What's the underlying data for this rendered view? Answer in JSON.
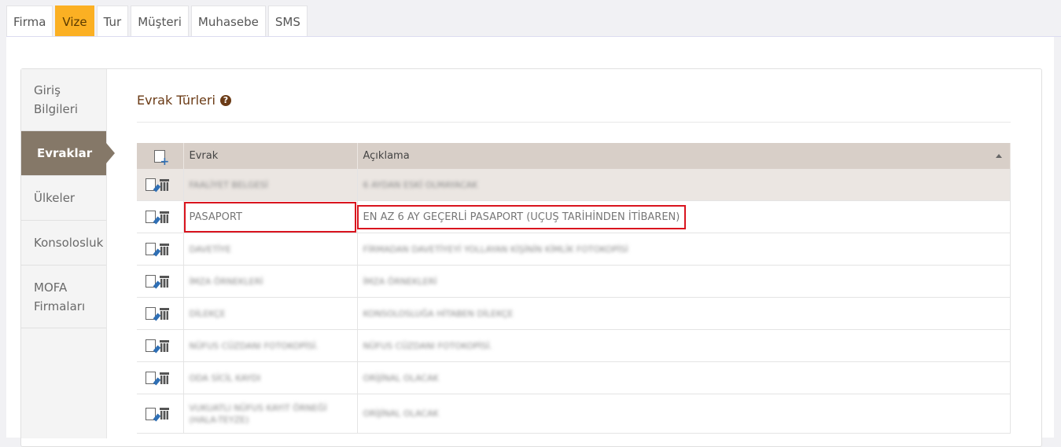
{
  "tabs": [
    "Firma",
    "Vize",
    "Tur",
    "Müşteri",
    "Muhasebe",
    "SMS"
  ],
  "active_tab": "Vize",
  "sidenav": [
    {
      "label": "Giriş Bilgileri",
      "lines": [
        "Giriş",
        "Bilgileri"
      ]
    },
    {
      "label": "Evraklar",
      "lines": [
        "Evraklar"
      ]
    },
    {
      "label": "Ülkeler",
      "lines": [
        "Ülkeler"
      ]
    },
    {
      "label": "Konsolosluk",
      "lines": [
        "Konsolosluk"
      ]
    },
    {
      "label": "MOFA Firmaları",
      "lines": [
        "MOFA",
        "Firmaları"
      ]
    }
  ],
  "active_nav": "Evraklar",
  "section_title": "Evrak Türleri",
  "table": {
    "columns": [
      "",
      "Evrak",
      "Açıklama"
    ],
    "rows": [
      {
        "evrak": "FAALİYET BELGESİ",
        "aciklama": "6 AYDAN ESKİ OLMAYACAK",
        "blurred": true
      },
      {
        "evrak": "PASAPORT",
        "aciklama": "EN AZ 6 AY GEÇERLİ PASAPORT (UÇUŞ TARİHİNDEN İTİBAREN)",
        "blurred": false,
        "highlighted": true
      },
      {
        "evrak": "DAVETİYE",
        "aciklama": "FİRMADAN DAVETİYEYİ YOLLAYAN KİŞİNİN KİMLİK FOTOKOPİSİ",
        "blurred": true
      },
      {
        "evrak": "İMZA ÖRNEKLERİ",
        "aciklama": "İMZA ÖRNEKLERİ",
        "blurred": true
      },
      {
        "evrak": "DİLEKÇE",
        "aciklama": "KONSOLOSLUĞA HİTABEN DİLEKÇE",
        "blurred": true
      },
      {
        "evrak": "NÜFUS CÜZDANI FOTOKOPİSİ.",
        "aciklama": "NÜFUS CÜZDANI FOTOKOPİSİ.",
        "blurred": true
      },
      {
        "evrak": "ODA SİCİL KAYDI",
        "aciklama": "ORİJİNAL OLACAK",
        "blurred": true
      },
      {
        "evrak": "VUKUATLI NÜFUS KAYIT ÖRNEĞİ (HALA-TEYZE)",
        "aciklama": "ORİJİNAL OLACAK",
        "blurred": true
      }
    ]
  }
}
